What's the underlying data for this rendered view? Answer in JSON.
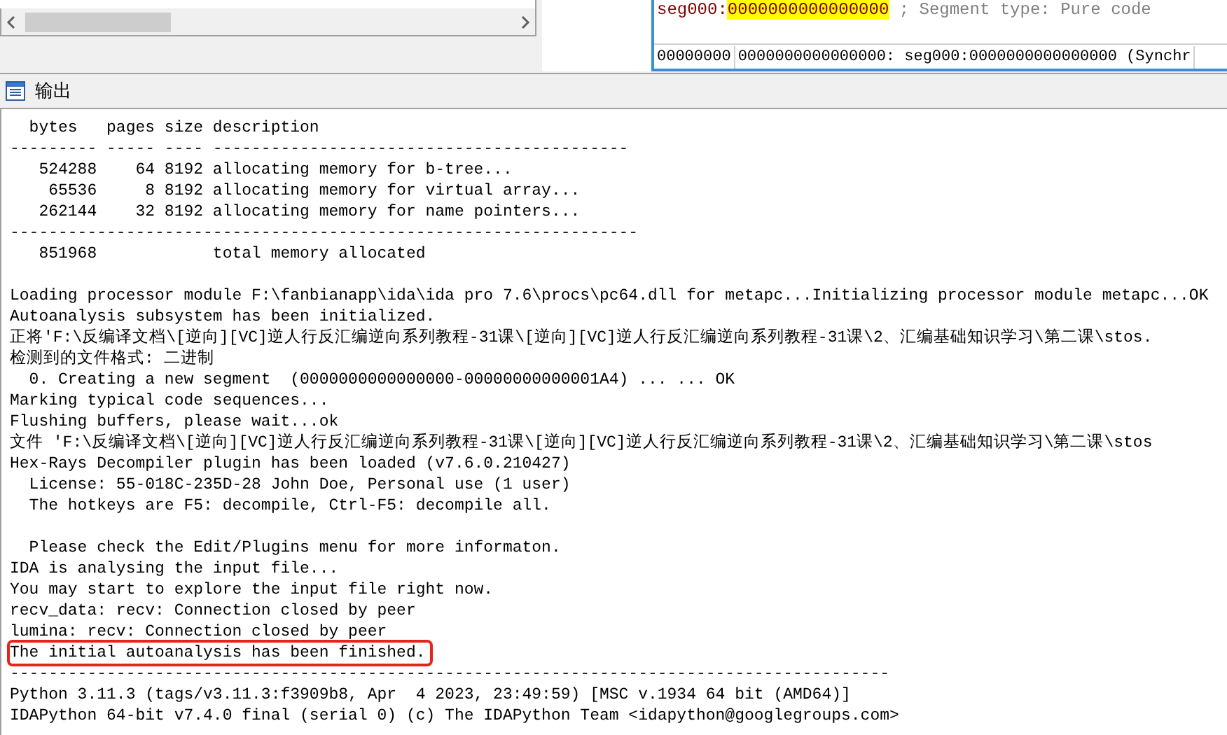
{
  "disassembly": {
    "segment": "seg000:",
    "address": "0000000000000000",
    "comment": "; Segment type: Pure code",
    "status": [
      "00000000",
      "0000000000000000: seg000:0000000000000000 (Synchr"
    ]
  },
  "output": {
    "title": "输出",
    "lines": [
      {
        "text": "  bytes   pages size description",
        "boxed": false
      },
      {
        "text": "--------- ----- ---- -------------------------------------------",
        "boxed": false
      },
      {
        "text": "   524288    64 8192 allocating memory for b-tree...",
        "boxed": false
      },
      {
        "text": "    65536     8 8192 allocating memory for virtual array...",
        "boxed": false
      },
      {
        "text": "   262144    32 8192 allocating memory for name pointers...",
        "boxed": false
      },
      {
        "text": "-----------------------------------------------------------------",
        "boxed": false
      },
      {
        "text": "   851968            total memory allocated",
        "boxed": false
      },
      {
        "kind": "blank"
      },
      {
        "text": "Loading processor module F:\\fanbianapp\\ida\\ida pro 7.6\\procs\\pc64.dll for metapc...Initializing processor module metapc...OK",
        "boxed": false
      },
      {
        "text": "Autoanalysis subsystem has been initialized.",
        "boxed": false
      },
      {
        "text": "正将'F:\\反编译文档\\[逆向][VC]逆人行反汇编逆向系列教程-31课\\[逆向][VC]逆人行反汇编逆向系列教程-31课\\2、汇编基础知识学习\\第二课\\stos.",
        "boxed": false
      },
      {
        "text": "检测到的文件格式: 二进制",
        "boxed": false
      },
      {
        "text": "  0. Creating a new segment  (0000000000000000-00000000000001A4) ... ... OK",
        "boxed": false
      },
      {
        "text": "Marking typical code sequences...",
        "boxed": false
      },
      {
        "text": "Flushing buffers, please wait...ok",
        "boxed": false
      },
      {
        "text": "文件 'F:\\反编译文档\\[逆向][VC]逆人行反汇编逆向系列教程-31课\\[逆向][VC]逆人行反汇编逆向系列教程-31课\\2、汇编基础知识学习\\第二课\\stos",
        "boxed": false
      },
      {
        "text": "Hex-Rays Decompiler plugin has been loaded (v7.6.0.210427)",
        "boxed": false
      },
      {
        "text": "  License: 55-018C-235D-28 John Doe, Personal use (1 user)",
        "boxed": false
      },
      {
        "text": "  The hotkeys are F5: decompile, Ctrl-F5: decompile all.",
        "boxed": false
      },
      {
        "kind": "blank"
      },
      {
        "text": "  Please check the Edit/Plugins menu for more informaton.",
        "boxed": false
      },
      {
        "text": "IDA is analysing the input file...",
        "boxed": false
      },
      {
        "text": "You may start to explore the input file right now.",
        "boxed": false
      },
      {
        "text": "recv_data: recv: Connection closed by peer",
        "boxed": false
      },
      {
        "text": "lumina: recv: Connection closed by peer",
        "boxed": false
      },
      {
        "text": "The initial autoanalysis has been finished.",
        "boxed": true
      },
      {
        "text": "-------------------------------------------------------------------------------------------",
        "boxed": false
      },
      {
        "text": "Python 3.11.3 (tags/v3.11.3:f3909b8, Apr  4 2023, 23:49:59) [MSC v.1934 64 bit (AMD64)]",
        "boxed": false
      },
      {
        "text": "IDAPython 64-bit v7.4.0 final (serial 0) (c) The IDAPython Team <idapython@googlegroups.com>",
        "boxed": false
      }
    ]
  }
}
